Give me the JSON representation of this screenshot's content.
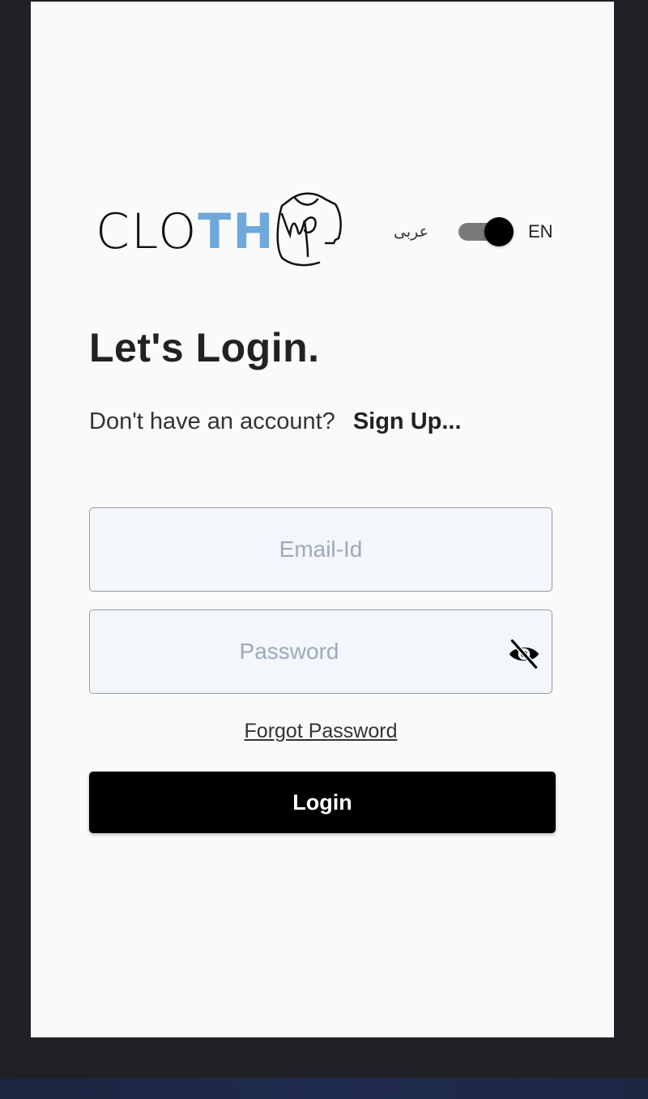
{
  "colors": {
    "background": "#202124",
    "screen": "#fafafa",
    "accent_logo": "#6fa8dc",
    "field_bg": "#f3f6fa",
    "button_bg": "#000000",
    "placeholder": "#9daabc"
  },
  "logo": {
    "text_plain": "CLO",
    "text_accent": "TH",
    "script": "up"
  },
  "language": {
    "arabic_label": "عربى",
    "english_label": "EN",
    "toggle_state": "on"
  },
  "heading": {
    "title": "Let's Login."
  },
  "signup": {
    "prompt": "Don't have an account?",
    "link": "Sign Up..."
  },
  "form": {
    "email_placeholder": "Email-Id",
    "password_placeholder": "Password",
    "password_toggle_icon": "eye-off-icon",
    "forgot_label": "Forgot Password",
    "login_label": "Login"
  }
}
